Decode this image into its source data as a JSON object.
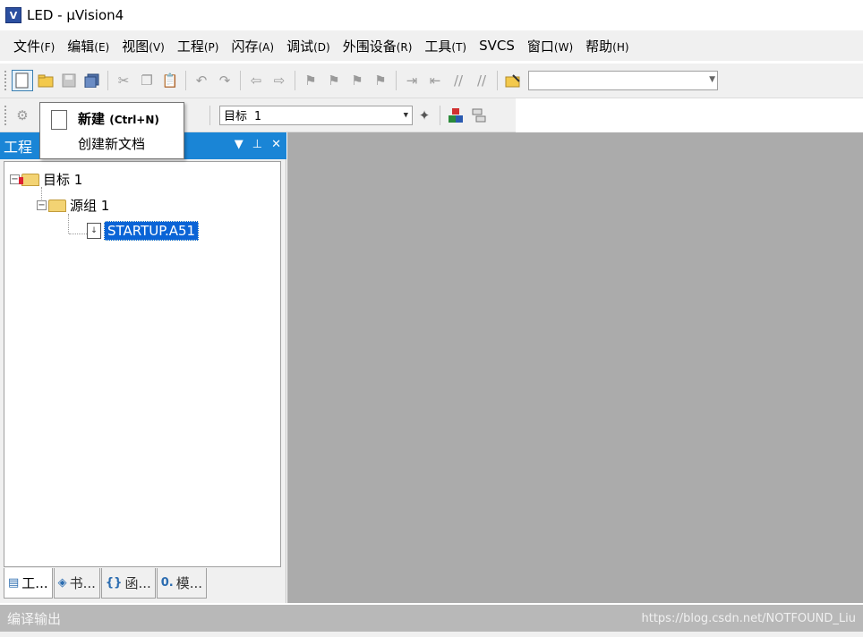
{
  "window": {
    "title": "LED  - µVision4",
    "icon_text": "V"
  },
  "menu": [
    {
      "label": "文件",
      "hotkey": "(F)"
    },
    {
      "label": "编辑",
      "hotkey": "(E)"
    },
    {
      "label": "视图",
      "hotkey": "(V)"
    },
    {
      "label": "工程",
      "hotkey": "(P)"
    },
    {
      "label": "闪存",
      "hotkey": "(A)"
    },
    {
      "label": "调试",
      "hotkey": "(D)"
    },
    {
      "label": "外围设备",
      "hotkey": "(R)"
    },
    {
      "label": "工具",
      "hotkey": "(T)"
    },
    {
      "label": "SVCS",
      "hotkey": ""
    },
    {
      "label": "窗口",
      "hotkey": "(W)"
    },
    {
      "label": "帮助",
      "hotkey": "(H)"
    }
  ],
  "toolbar2": {
    "target_value": "目标 1"
  },
  "tooltip": {
    "title": "新建",
    "shortcut": "(Ctrl+N)",
    "description": "创建新文档"
  },
  "project_panel": {
    "title": "工程",
    "tree": {
      "target": "目标 1",
      "group": "源组 1",
      "file": "STARTUP.A51"
    },
    "tabs": [
      {
        "label": "工...",
        "icon": "project-tab-icon"
      },
      {
        "label": "书...",
        "icon": "books-tab-icon"
      },
      {
        "label": "函...",
        "icon": "functions-tab-icon",
        "glyph": "{}"
      },
      {
        "label": "模...",
        "icon": "templates-tab-icon",
        "glyph": "0."
      }
    ]
  },
  "output": {
    "title": "编译输出",
    "watermark": "https://blog.csdn.net/NOTFOUND_Liu"
  }
}
